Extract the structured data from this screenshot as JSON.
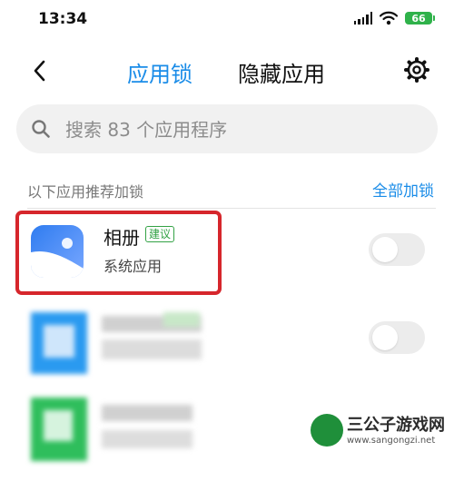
{
  "status_bar": {
    "time": "13:34",
    "battery_level": "66"
  },
  "nav": {
    "tab_app_lock": "应用锁",
    "tab_hidden_apps": "隐藏应用"
  },
  "search": {
    "placeholder": "搜索 83 个应用程序"
  },
  "section": {
    "title": "以下应用推荐加锁",
    "lock_all": "全部加锁"
  },
  "apps": [
    {
      "name": "相册",
      "badge": "建议",
      "subtitle": "系统应用",
      "locked": false,
      "icon": "gallery-icon"
    },
    {
      "name": "",
      "subtitle": "",
      "locked": false,
      "icon": "blurred-app-icon",
      "blurred": true
    },
    {
      "name": "",
      "subtitle": "",
      "locked": false,
      "icon": "blurred-app-icon",
      "blurred": true
    }
  ],
  "colors": {
    "accent": "#1a8ce8",
    "highlight": "#d6262c",
    "badge_green": "#33a245"
  },
  "watermark": {
    "title": "三公子游戏网",
    "url": "www.sangongzi.net"
  }
}
